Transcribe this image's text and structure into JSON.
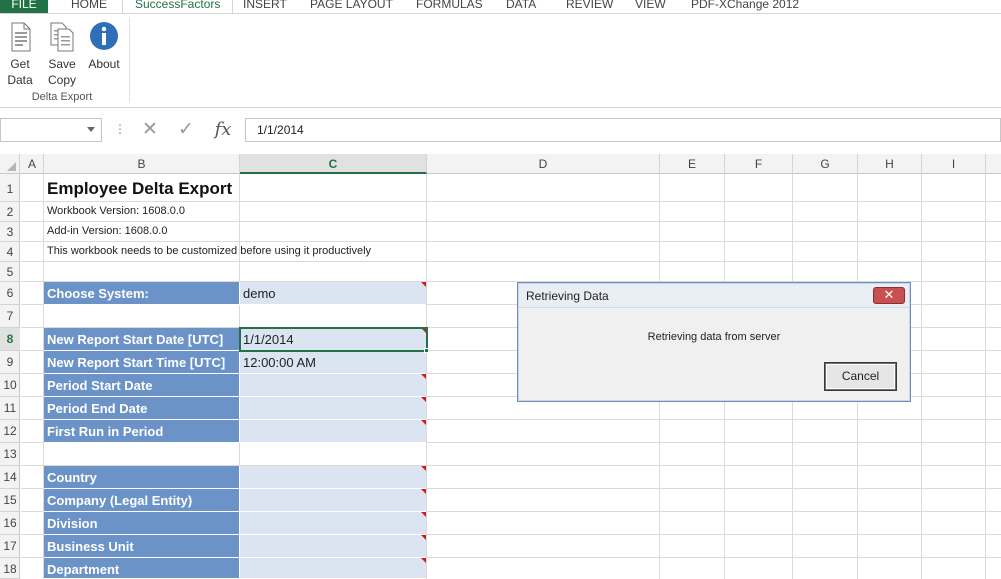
{
  "ribbon": {
    "tabs": [
      "FILE",
      "HOME",
      "SuccessFactors",
      "INSERT",
      "PAGE LAYOUT",
      "FORMULAS",
      "DATA",
      "REVIEW",
      "VIEW",
      "PDF-XChange 2012"
    ],
    "active_tab": "SuccessFactors",
    "buttons": {
      "get_data": {
        "line1": "Get",
        "line2": "Data",
        "icon": "document-data-icon"
      },
      "save_copy": {
        "line1": "Save",
        "line2": "Copy",
        "icon": "copy-documents-icon"
      },
      "about": {
        "line1": "About",
        "icon": "info-icon"
      }
    },
    "group_label": "Delta Export"
  },
  "formula_bar": {
    "name_box": "",
    "cancel_icon": "✕",
    "enter_icon": "✓",
    "fx": "fx",
    "content": "1/1/2014"
  },
  "sheet": {
    "columns": [
      "A",
      "B",
      "C",
      "D",
      "E",
      "F",
      "G",
      "H",
      "I"
    ],
    "selected_column": "C",
    "rows": [
      "1",
      "2",
      "3",
      "4",
      "5",
      "6",
      "7",
      "8",
      "9",
      "10",
      "11",
      "12",
      "13",
      "14",
      "15",
      "16",
      "17",
      "18"
    ],
    "selected_row": "8",
    "title": "Employee Delta Export",
    "workbook_version": "Workbook Version: 1608.0.0",
    "addin_version": "Add-in Version: 1608.0.0",
    "notice": "This workbook needs to be customized before using it productively",
    "fields": [
      {
        "row": 6,
        "label": "Choose System:",
        "value": "demo"
      },
      {
        "row": 8,
        "label": "New Report Start Date [UTC]",
        "value": "1/1/2014"
      },
      {
        "row": 9,
        "label": "New Report Start Time [UTC]",
        "value": "12:00:00 AM"
      },
      {
        "row": 10,
        "label": "Period Start Date",
        "value": ""
      },
      {
        "row": 11,
        "label": "Period End Date",
        "value": ""
      },
      {
        "row": 12,
        "label": "First Run in Period",
        "value": ""
      },
      {
        "row": 14,
        "label": "Country",
        "value": ""
      },
      {
        "row": 15,
        "label": "Company (Legal Entity)",
        "value": ""
      },
      {
        "row": 16,
        "label": "Division",
        "value": ""
      },
      {
        "row": 17,
        "label": "Business Unit",
        "value": ""
      },
      {
        "row": 18,
        "label": "Department",
        "value": ""
      }
    ]
  },
  "dialog": {
    "title": "Retrieving Data",
    "close_glyph": "✕",
    "message": "Retrieving data from server",
    "cancel_label": "Cancel"
  },
  "colors": {
    "excel_green": "#217346",
    "label_fill": "#6b93c8",
    "value_fill": "#dbe5f1",
    "comment_marker": "#d11a1a"
  }
}
